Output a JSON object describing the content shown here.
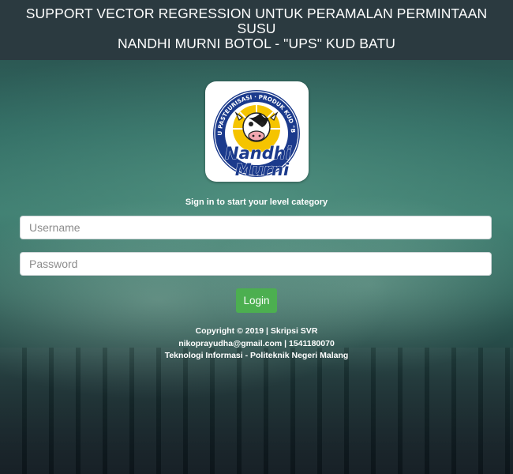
{
  "header": {
    "title": "SUPPORT VECTOR REGRESSION UNTUK PERAMALAN PERMINTAAN SUSU\nNANDHI MURNI BOTOL - \"UPS\" KUD BATU"
  },
  "logo": {
    "ring_text": "SUSU PASTEURISASI · PRODUK KUD \"BATU\"",
    "brand_line1": "Nandhi",
    "brand_line2": "Murni"
  },
  "login": {
    "subtitle": "Sign in to start your level category",
    "username_placeholder": "Username",
    "password_placeholder": "Password",
    "button_label": "Login"
  },
  "footer": {
    "line1": "Copyright © 2019 | Skripsi SVR",
    "line2": "nikoprayudha@gmail.com | 1541180070",
    "line3": "Teknologi Informasi - Politeknik Negeri Malang"
  },
  "colors": {
    "header_bg": "#2b3a40",
    "button_bg": "#4caf50",
    "logo_navy": "#1b3a8c",
    "logo_yellow": "#f5c400"
  }
}
